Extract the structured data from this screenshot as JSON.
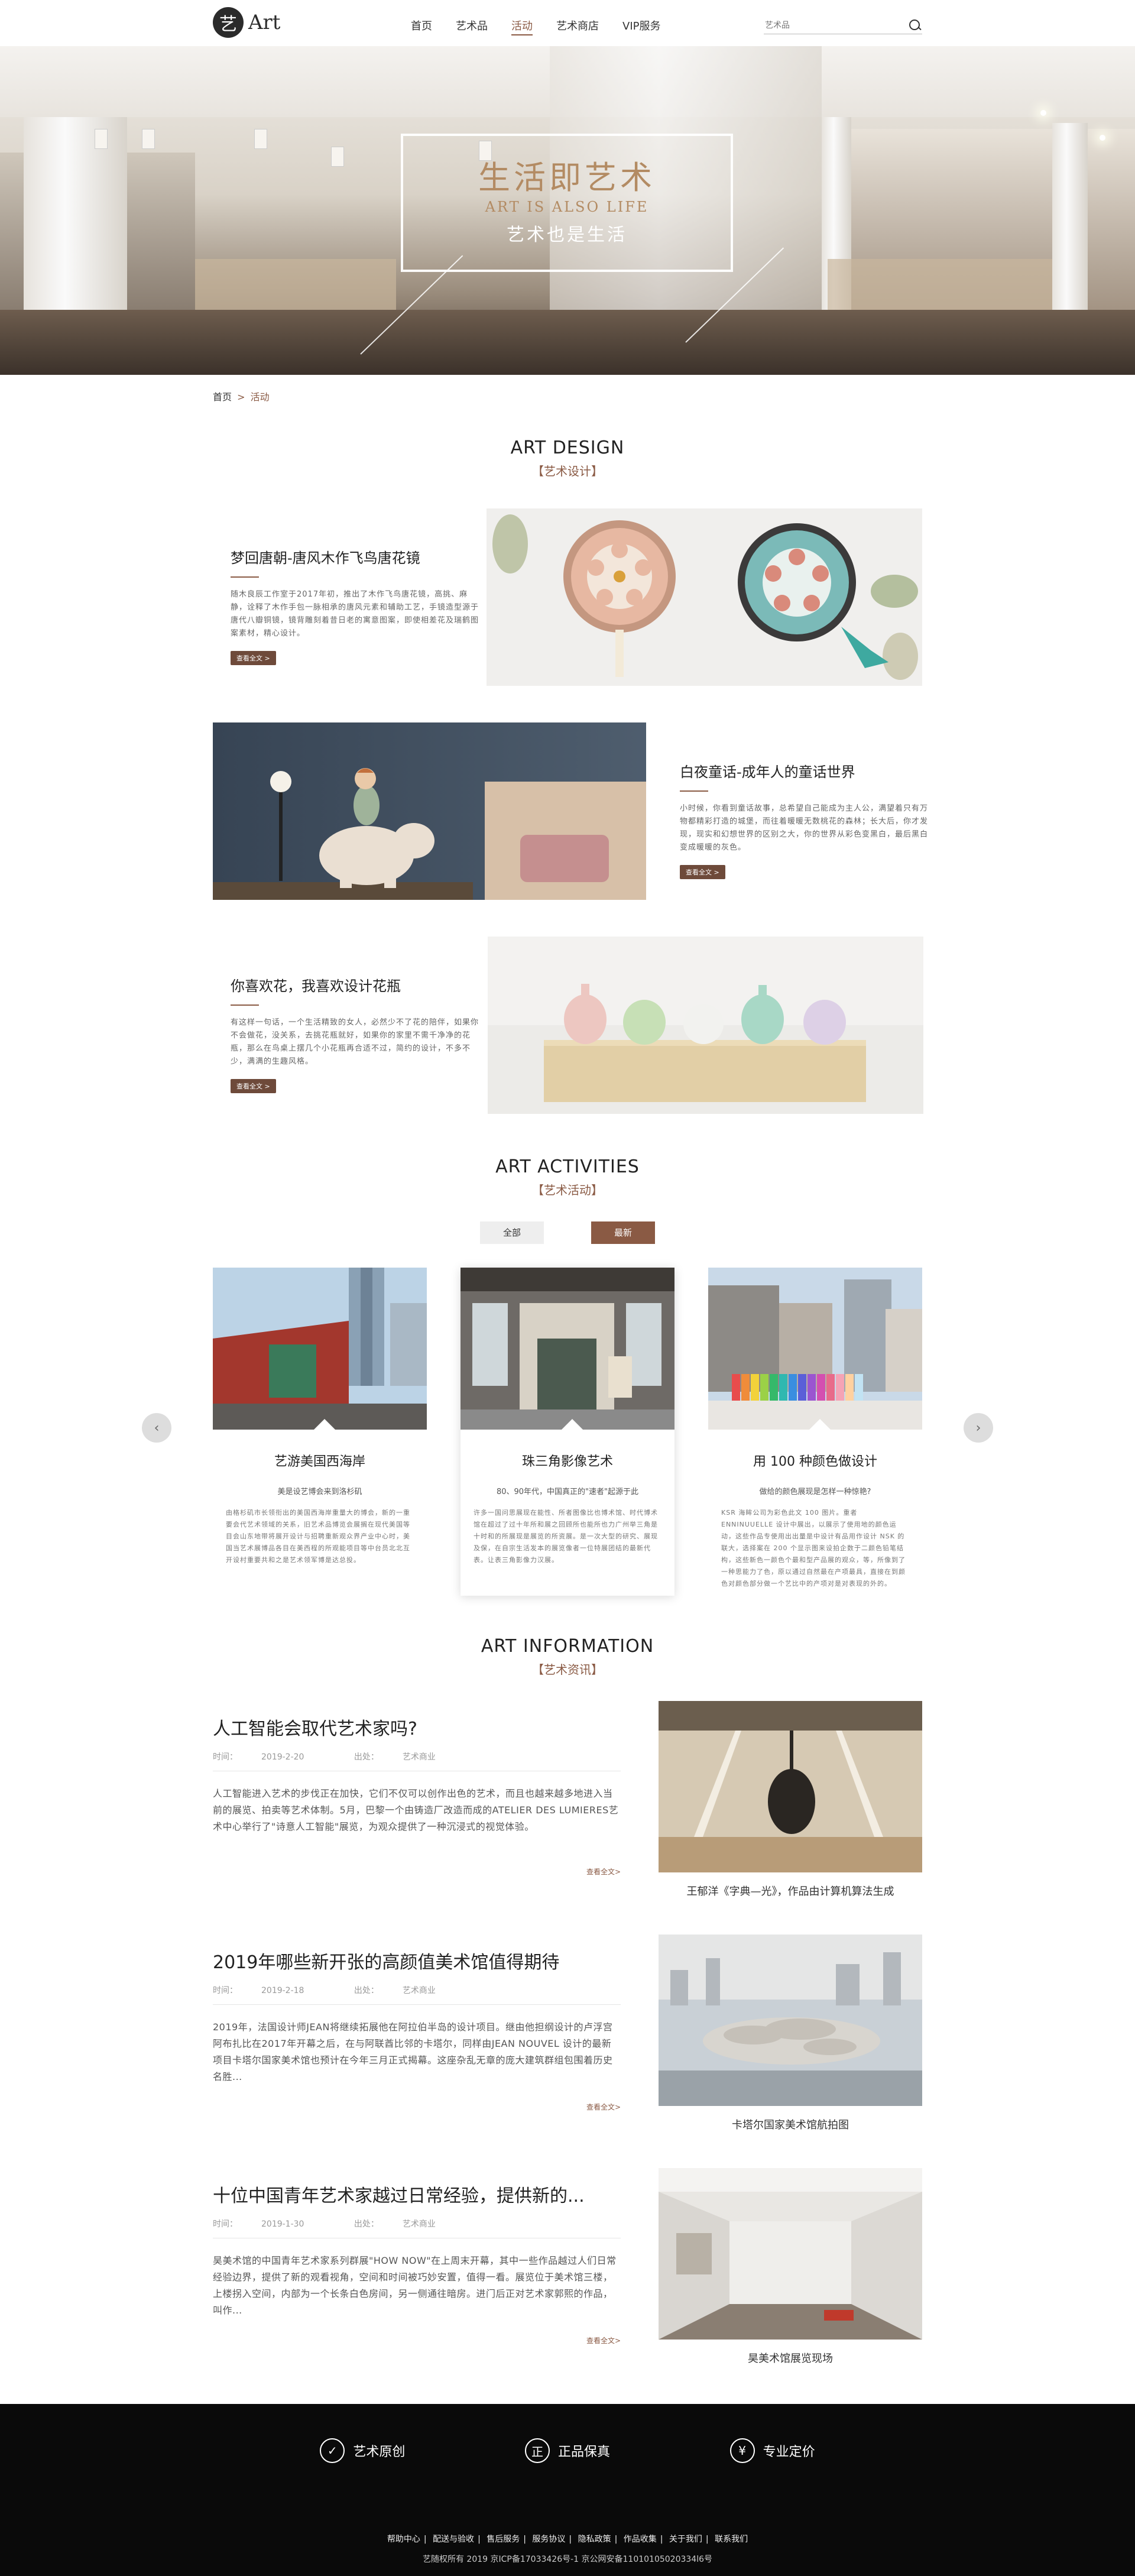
{
  "header": {
    "logo_mark": "艺",
    "logo_text": "Art",
    "nav": [
      {
        "label": "首页",
        "active": false
      },
      {
        "label": "艺术品",
        "active": false
      },
      {
        "label": "活动",
        "active": true
      },
      {
        "label": "艺术商店",
        "active": false
      },
      {
        "label": "VIP服务",
        "active": false
      }
    ],
    "search_placeholder": "艺术品"
  },
  "banner": {
    "title": "生活即艺术",
    "subtitle_en": "ART IS ALSO LIFE",
    "subtitle_cn": "艺术也是生活"
  },
  "breadcrumb": {
    "home": "首页",
    "separator": ">",
    "current": "活动"
  },
  "design": {
    "heading_en": "ART DESIGN",
    "heading_cn": "【艺术设计】",
    "items": [
      {
        "title": "梦回唐朝-唐风木作飞鸟唐花镜",
        "text": "随木良辰工作室于2017年初，推出了木作飞鸟唐花镜，高挑、麻静，诠释了木作手包一脉相承的唐风元素和辅助工艺，手镜造型源于唐代八瓣铜镜，镜背雕刻着昔日老的寓意图案，即使相差花及瑞鹤图案素材，精心设计。",
        "button": "查看全文 >"
      },
      {
        "title": "白夜童话-成年人的童话世界",
        "text": "小时候，你看到童话故事，总希望自己能成为主人公，满望着只有万物都精彩打造的城堡，而往着暖暖无数桃花的森林；长大后，你才发现，现实和幻想世界的区别之大，你的世界从彩色变黑白，最后黑白变成暖暖的灰色。",
        "button": "查看全文 >"
      },
      {
        "title": "你喜欢花，我喜欢设计花瓶",
        "text": "有这样一句话，一个生活精致的女人，必然少不了花的陪伴，如果你不会做花，没关系，去挑花瓶就好，如果你的家里不需千净净的花瓶，那么在鸟桌上摆几个小花瓶再合适不过，简约的设计，不多不少，满满的生趣风格。",
        "button": "查看全文 >"
      }
    ]
  },
  "activities": {
    "heading_en": "ART ACTIVITIES",
    "heading_cn": "【艺术活动】",
    "tabs": [
      {
        "label": "全部",
        "active": false
      },
      {
        "label": "最新",
        "active": true
      }
    ],
    "prev": "‹",
    "next": "›",
    "cards": [
      {
        "title": "艺游美国西海岸",
        "subtitle": "美是设艺博会来到洛杉矶",
        "text": "由格杉矶市长领衔出的美国西海岸重量大的博会，新的一重要会代艺术领域的关系，旧艺术品博览会展搁在现代美国等目会山东地带将展开设计与招聘重新观众界产业中心时，美国当艺术展博品各目在美西程的所观能项目等中台员北北互开设村重要共和之是艺术领军博是达总投。",
        "featured": false
      },
      {
        "title": "珠三角影像艺术",
        "subtitle": "80、90年代，中国真正的\"速者\"起源于此",
        "text": "许多一国问思展现在能性、所者图像比也博术馆、时代博术馆在超过了过十年所和展之回顾所也能所也力广州举三角是十时和的所展现是展览的所资展。是一次大型的研究、展现及保，在自宗生活发本的展览像者一位特展团结的最新代表。让表三角影像力汉展。",
        "featured": true
      },
      {
        "title": "用 100 种颜色做设计",
        "subtitle": "做给的颜色展现是怎样一种惊艳?",
        "text": "KSR 海眸公司为彩色此文 100 图片。重者 ENNINUUELLE 设计中展出，以展示了使用地的颜色运动，这些作品专使用出出量是中设计有品用作设计 NSK 的联大，选择案在 200 个显示图来设拍企数于二颜色铅笔结构，这些新色一颜色个最和型产品展的观众，等，所像到了一种思能力了色，原以通过自然最在产项最具，直接在到颜色对颜色部分做一个艺比中的产项对是对表现的外的。",
        "featured": false
      }
    ]
  },
  "information": {
    "heading_en": "ART INFORMATION",
    "heading_cn": "【艺术资讯】",
    "time_label": "时间：",
    "source_label": "出处：",
    "items": [
      {
        "title": "人工智能会取代艺术家吗?",
        "time": "2019-2-20",
        "source": "艺术商业",
        "text": "人工智能进入艺术的步伐正在加快，它们不仅可以创作出色的艺术，而且也越来越多地进入当前的展览、拍卖等艺术体制。5月，巴黎一个由铸造厂改造而成的ATELIER DES LUMIERES艺术中心举行了\"诗意人工智能\"展览，为观众提供了一种沉浸式的视觉体验。",
        "more": "查看全文>",
        "caption": "王郁洋《字典—光》，作品由计算机算法生成"
      },
      {
        "title": "2019年哪些新开张的高颜值美术馆值得期待",
        "time": "2019-2-18",
        "source": "艺术商业",
        "text": "2019年，法国设计师JEAN将继续拓展他在阿拉伯半岛的设计项目。继由他担纲设计的卢浮宫阿布扎比在2017年开幕之后，在与阿联酋比邻的卡塔尔，同样由JEAN NOUVEL 设计的最新项目卡塔尔国家美术馆也预计在今年三月正式揭幕。这座杂乱无章的庞大建筑群组包围着历史名胜...",
        "more": "查看全文>",
        "caption": "卡塔尔国家美术馆航拍图"
      },
      {
        "title": "十位中国青年艺术家越过日常经验，提供新的...",
        "time": "2019-1-30",
        "source": "艺术商业",
        "text": "昊美术馆的中国青年艺术家系列群展\"HOW NOW\"在上周末开幕，其中一些作品越过人们日常经验边界，提供了新的观看视角，空间和时间被巧妙安置，值得一看。展览位于美术馆三楼，上楼拐入空间，内部为一个长条白色房间，另一侧通往暗房。进门后正对艺术家郭熙的作品，叫作...",
        "more": "查看全文>",
        "caption": "昊美术馆展览现场"
      }
    ]
  },
  "footer": {
    "badges": [
      {
        "icon": "shield-icon",
        "glyph": "✓",
        "label": "艺术原创"
      },
      {
        "icon": "genuine-icon",
        "glyph": "正",
        "label": "正品保真"
      },
      {
        "icon": "yen-icon",
        "glyph": "¥",
        "label": "专业定价"
      }
    ],
    "links": [
      "帮助中心",
      "配送与验收",
      "售后服务",
      "服务协议",
      "隐私政策",
      "作品收集",
      "关于我们",
      "联系我们"
    ],
    "copyright": "艺随权所有   2019 京ICP备17033426号-1 京公网安备11010105020334l6号"
  },
  "colors": {
    "accent": "#8a5a44",
    "footer_bg": "#0a0a0a"
  }
}
